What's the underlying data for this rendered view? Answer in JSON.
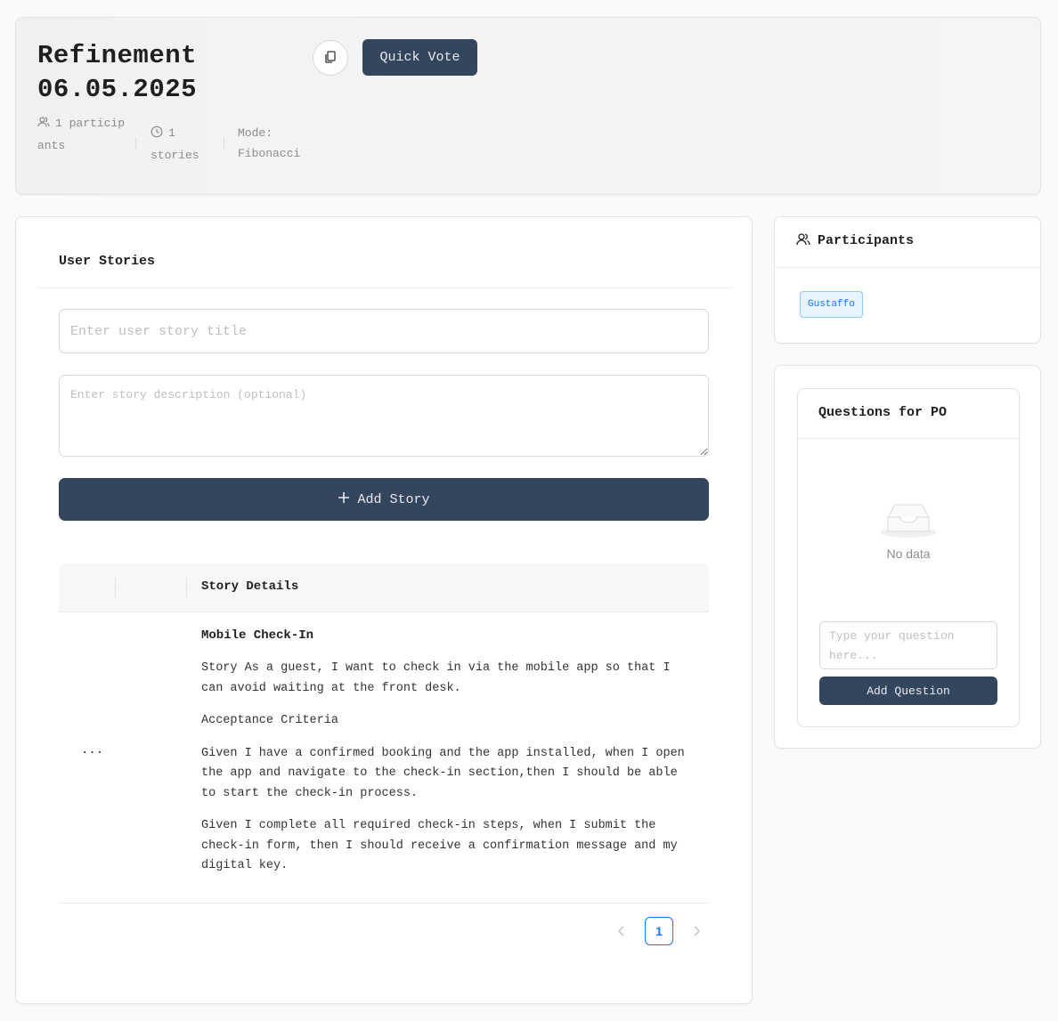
{
  "session": {
    "title": "Refinement 06.05.2025",
    "quick_vote_label": "Quick Vote",
    "participants_count": "1 participants",
    "stories_count": "1 stories",
    "mode": "Mode: Fibonacci"
  },
  "stories_panel": {
    "title": "User Stories",
    "title_placeholder": "Enter user story title",
    "description_placeholder": "Enter story description (optional)",
    "add_story_label": "Add Story",
    "table_header": "Story Details",
    "rows": [
      {
        "actions": "...",
        "title": "Mobile Check-In",
        "paragraphs": [
          "Story As a guest, I want to check in via the mobile app so that I can avoid waiting at the front desk.",
          "Acceptance Criteria",
          "Given I have a confirmed booking and the app installed, when I open the app and navigate to the check-in section,then I should be able to start the check-in process.",
          "Given I complete all required check-in steps, when I submit the check-in form, then I should receive a confirmation message and my digital key."
        ]
      }
    ],
    "pagination": {
      "current_page": "1"
    }
  },
  "participants_panel": {
    "title": "Participants",
    "participants": [
      "Gustaffo"
    ]
  },
  "questions_panel": {
    "title": "Questions for PO",
    "empty_text": "No data",
    "question_placeholder": "Type your question here...",
    "add_question_label": "Add Question"
  },
  "icons": {
    "copy": "copy-icon",
    "participants": "users-icon",
    "stories": "clock-icon",
    "add": "plus-icon",
    "empty": "inbox-icon",
    "prev": "chevron-left-icon",
    "next": "chevron-right-icon"
  },
  "colors": {
    "primary_button": "#34455e",
    "accent": "#1677ff",
    "tag_bg": "#e6f4ff"
  }
}
